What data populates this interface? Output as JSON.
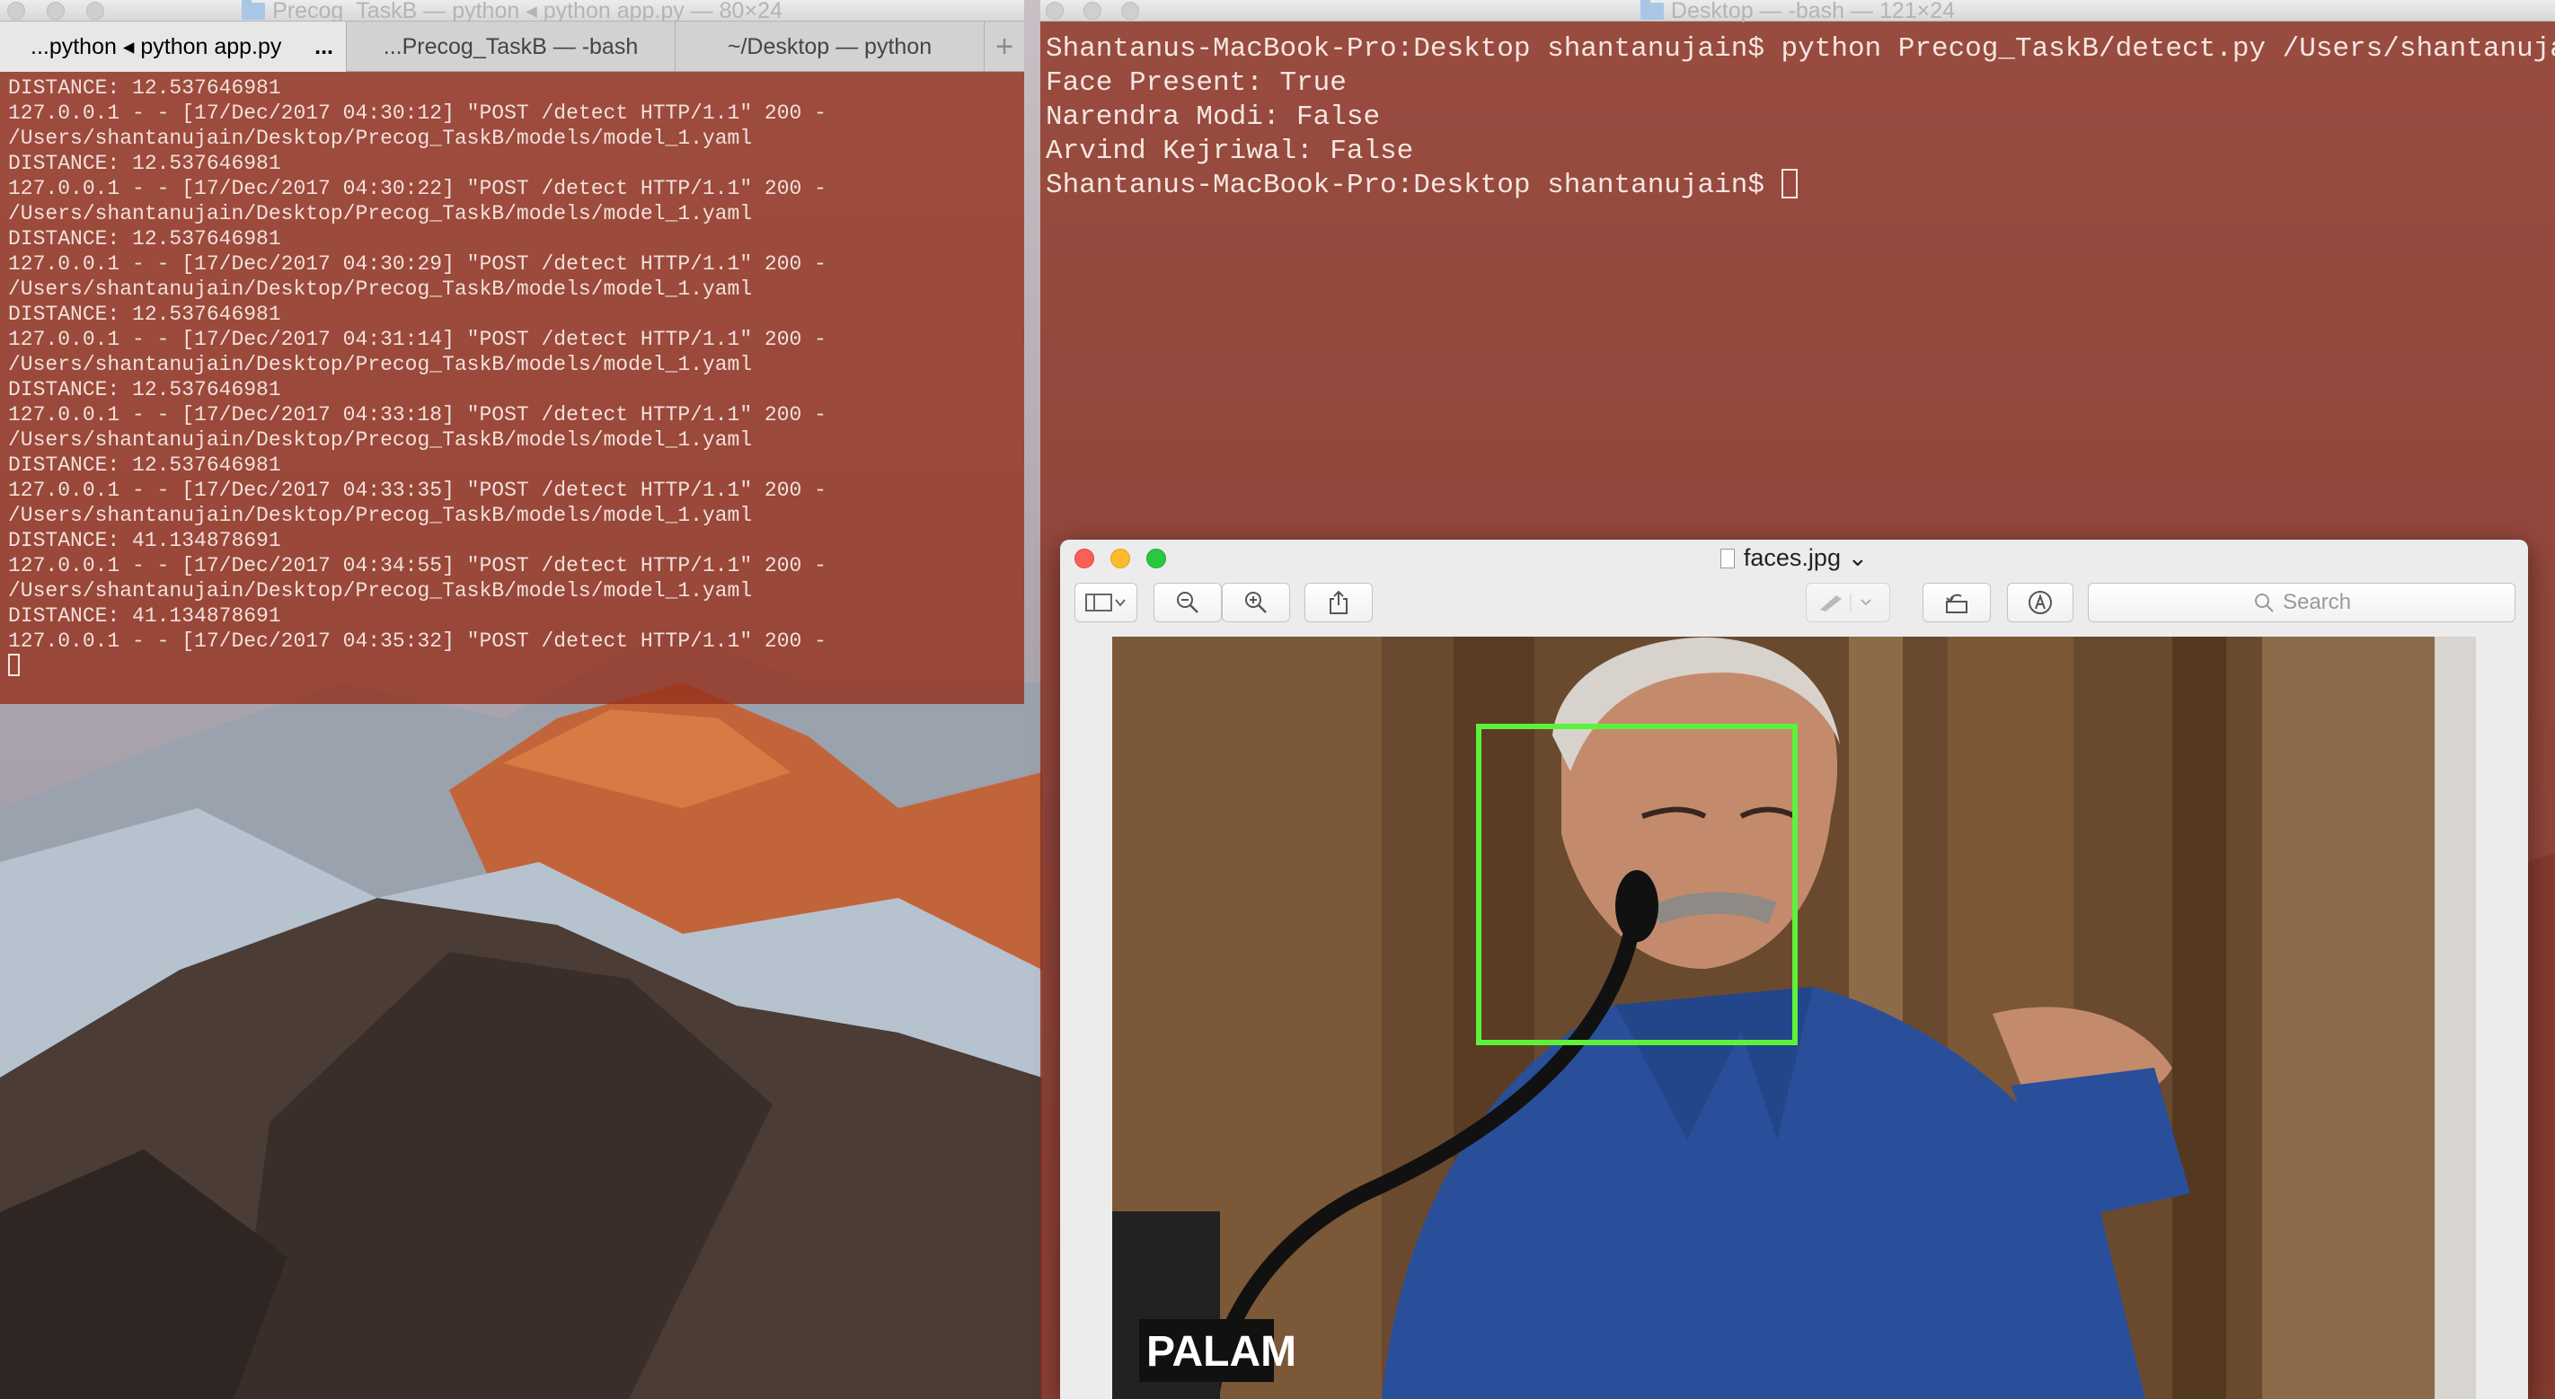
{
  "left_terminal": {
    "title": "Precog_TaskB — python ◂ python app.py — 80×24",
    "tabs": [
      {
        "label": "...python ◂ python app.py",
        "extra": "..."
      },
      {
        "label": "...Precog_TaskB — -bash"
      },
      {
        "label": "~/Desktop — python"
      }
    ],
    "new_tab": "+",
    "output": "DISTANCE: 12.537646981\n127.0.0.1 - - [17/Dec/2017 04:30:12] \"POST /detect HTTP/1.1\" 200 -\n/Users/shantanujain/Desktop/Precog_TaskB/models/model_1.yaml\nDISTANCE: 12.537646981\n127.0.0.1 - - [17/Dec/2017 04:30:22] \"POST /detect HTTP/1.1\" 200 -\n/Users/shantanujain/Desktop/Precog_TaskB/models/model_1.yaml\nDISTANCE: 12.537646981\n127.0.0.1 - - [17/Dec/2017 04:30:29] \"POST /detect HTTP/1.1\" 200 -\n/Users/shantanujain/Desktop/Precog_TaskB/models/model_1.yaml\nDISTANCE: 12.537646981\n127.0.0.1 - - [17/Dec/2017 04:31:14] \"POST /detect HTTP/1.1\" 200 -\n/Users/shantanujain/Desktop/Precog_TaskB/models/model_1.yaml\nDISTANCE: 12.537646981\n127.0.0.1 - - [17/Dec/2017 04:33:18] \"POST /detect HTTP/1.1\" 200 -\n/Users/shantanujain/Desktop/Precog_TaskB/models/model_1.yaml\nDISTANCE: 12.537646981\n127.0.0.1 - - [17/Dec/2017 04:33:35] \"POST /detect HTTP/1.1\" 200 -\n/Users/shantanujain/Desktop/Precog_TaskB/models/model_1.yaml\nDISTANCE: 41.134878691\n127.0.0.1 - - [17/Dec/2017 04:34:55] \"POST /detect HTTP/1.1\" 200 -\n/Users/shantanujain/Desktop/Precog_TaskB/models/model_1.yaml\nDISTANCE: 41.134878691\n127.0.0.1 - - [17/Dec/2017 04:35:32] \"POST /detect HTTP/1.1\" 200 -\n"
  },
  "right_terminal": {
    "title": "Desktop — -bash — 121×24",
    "output": "Shantanus-MacBook-Pro:Desktop shantanujain$ python Precog_TaskB/detect.py /Users/shantanujain\nFace Present: True\nNarendra Modi: False\nArvind Kejriwal: False\n",
    "prompt": "Shantanus-MacBook-Pro:Desktop shantanujain$ "
  },
  "preview": {
    "title": "faces.jpg",
    "search_placeholder": "Search",
    "photo_caption": "PALAM"
  },
  "colors": {
    "terminal_bg": "#9a3a24",
    "face_box": "#5cf23a",
    "shirt": "#2a4f9a"
  }
}
